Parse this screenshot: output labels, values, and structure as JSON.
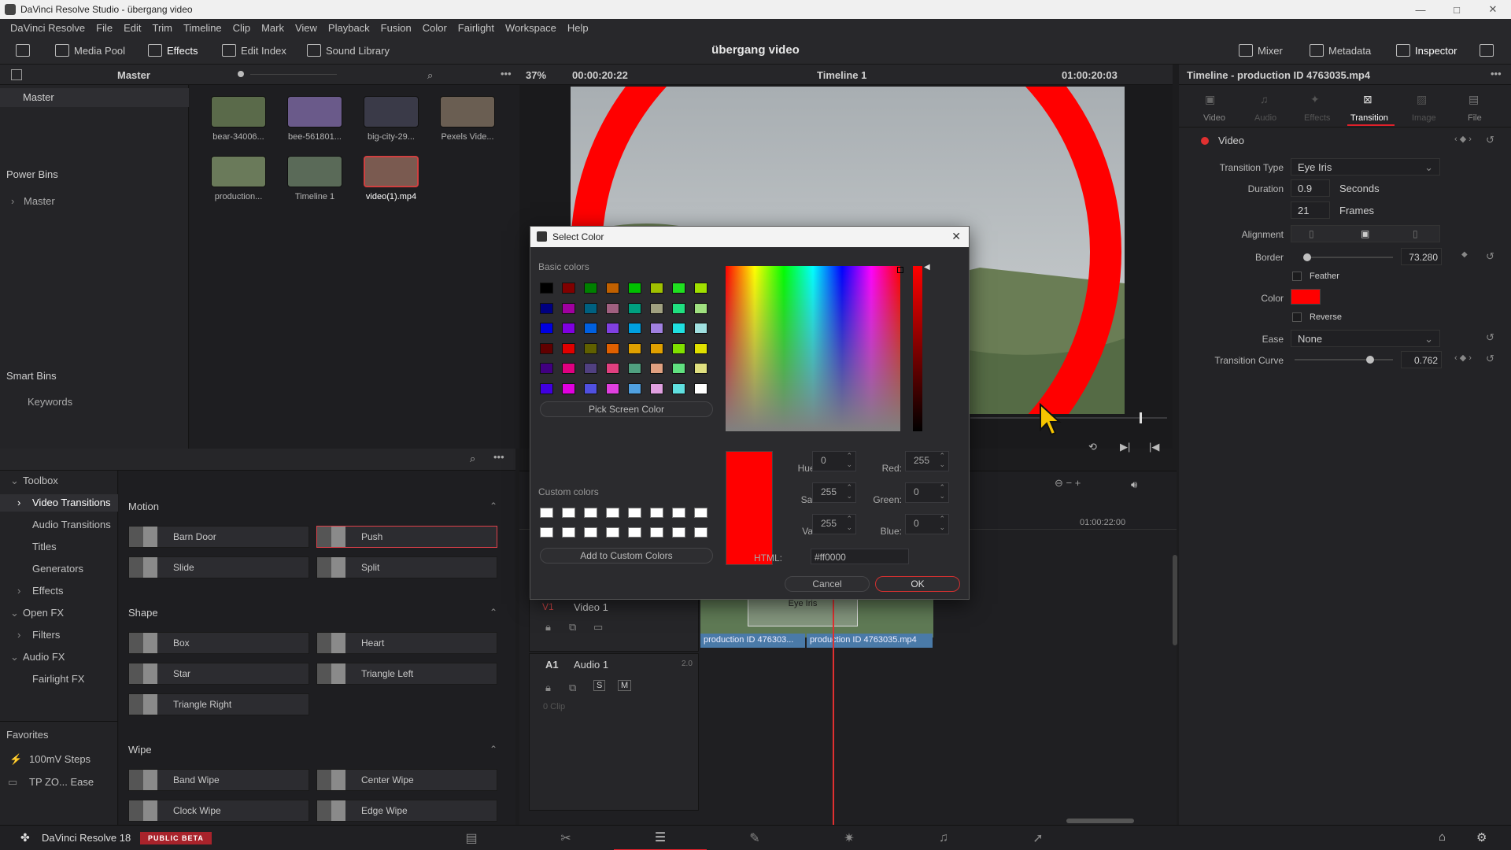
{
  "window": {
    "title": "DaVinci Resolve Studio - übergang video",
    "minimize": "—",
    "maximize": "□",
    "close": "✕"
  },
  "menu": [
    "DaVinci Resolve",
    "File",
    "Edit",
    "Trim",
    "Timeline",
    "Clip",
    "Mark",
    "View",
    "Playback",
    "Fusion",
    "Color",
    "Fairlight",
    "Workspace",
    "Help"
  ],
  "toolbar": {
    "media_pool": "Media Pool",
    "effects": "Effects",
    "edit_index": "Edit Index",
    "sound_library": "Sound Library",
    "project_title": "übergang video",
    "mixer": "Mixer",
    "metadata": "Metadata",
    "inspector": "Inspector"
  },
  "bins": {
    "header": "Master",
    "master": "Master",
    "power_bins": "Power Bins",
    "power_master": "Master",
    "smart_bins": "Smart Bins",
    "keywords": "Keywords"
  },
  "media": [
    {
      "label": "bear-34006...",
      "color": "#5a6a4a"
    },
    {
      "label": "bee-561801...",
      "color": "#6a5a8a"
    },
    {
      "label": "big-city-29...",
      "color": "#3a3a48"
    },
    {
      "label": "Pexels Vide...",
      "color": "#6a5e52"
    },
    {
      "label": "production...",
      "color": "#6a7a5a"
    },
    {
      "label": "Timeline 1",
      "color": "#5a6a58"
    },
    {
      "label": "video(1).mp4",
      "color": "#7a5a50"
    }
  ],
  "viewer": {
    "zoom": "37%",
    "source_tc": "00:00:20:22",
    "timeline_name": "Timeline 1",
    "record_tc": "01:00:20:03"
  },
  "effects_tree": {
    "toolbox": "Toolbox",
    "video_transitions": "Video Transitions",
    "audio_transitions": "Audio Transitions",
    "titles": "Titles",
    "generators": "Generators",
    "effects": "Effects",
    "open_fx": "Open FX",
    "filters": "Filters",
    "audio_fx": "Audio FX",
    "fairlight_fx": "Fairlight FX",
    "favorites": "Favorites",
    "fav1": "100mV Steps",
    "fav2": "TP ZO... Ease"
  },
  "effects_list": {
    "motion": "Motion",
    "barn_door": "Barn Door",
    "push": "Push",
    "slide": "Slide",
    "split": "Split",
    "shape": "Shape",
    "box": "Box",
    "heart": "Heart",
    "star": "Star",
    "triangle_left": "Triangle Left",
    "triangle_right": "Triangle Right",
    "wipe": "Wipe",
    "band_wipe": "Band Wipe",
    "center_wipe": "Center Wipe",
    "clock_wipe": "Clock Wipe",
    "edge_wipe": "Edge Wipe"
  },
  "dialog": {
    "title": "Select Color",
    "basic_colors": "Basic colors",
    "pick_screen": "Pick Screen Color",
    "custom_colors": "Custom colors",
    "add_custom": "Add to Custom Colors",
    "hue_label": "Hue:",
    "hue": "0",
    "sat_label": "Sat:",
    "sat": "255",
    "val_label": "Val:",
    "val": "255",
    "red_label": "Red:",
    "red": "255",
    "green_label": "Green:",
    "green": "0",
    "blue_label": "Blue:",
    "blue": "0",
    "html_label": "HTML:",
    "html": "#ff0000",
    "cancel": "Cancel",
    "ok": "OK",
    "swatches": [
      "#000000",
      "#800000",
      "#008000",
      "#c06000",
      "#00c000",
      "#a0c000",
      "#20e020",
      "#a0e000",
      "#000080",
      "#a000a0",
      "#006080",
      "#a06080",
      "#00a080",
      "#a0a080",
      "#20e080",
      "#a0e080",
      "#0000e0",
      "#8000e0",
      "#0060e0",
      "#8040e0",
      "#00a0e0",
      "#a080e0",
      "#20e0e0",
      "#a0e0e0",
      "#600000",
      "#e00000",
      "#606000",
      "#e06000",
      "#e0a000",
      "#e0a000",
      "#80e000",
      "#e0e000",
      "#400080",
      "#e00080",
      "#504080",
      "#e04080",
      "#50a080",
      "#e0a080",
      "#60e080",
      "#e0e080",
      "#4000e0",
      "#e000e0",
      "#5050e0",
      "#e040e0",
      "#50a0e0",
      "#e0a0e0",
      "#60e0e0",
      "#ffffff"
    ]
  },
  "timeline": {
    "tc_mark": "01:00:22:00",
    "v1": "V1",
    "video1": "Video 1",
    "a1": "A1",
    "audio1": "Audio 1",
    "audio_level": "2.0",
    "zero_clip": "0 Clip",
    "transition_label": "Eye Iris",
    "clip1": "production ID 476303...",
    "clip2": "production ID 4763035.mp4"
  },
  "inspector": {
    "title": "Timeline - production ID 4763035.mp4",
    "tabs": [
      "Video",
      "Audio",
      "Effects",
      "Transition",
      "Image",
      "File"
    ],
    "section": "Video",
    "transition_type_label": "Transition Type",
    "transition_type": "Eye Iris",
    "duration_label": "Duration",
    "duration_seconds": "0.9",
    "seconds_unit": "Seconds",
    "duration_frames": "21",
    "frames_unit": "Frames",
    "alignment_label": "Alignment",
    "border_label": "Border",
    "border": "73.280",
    "feather_label": "Feather",
    "color_label": "Color",
    "reverse_label": "Reverse",
    "ease_label": "Ease",
    "ease": "None",
    "curve_label": "Transition Curve",
    "curve": "0.762"
  },
  "bottom": {
    "app": "DaVinci Resolve 18",
    "badge": "PUBLIC BETA"
  },
  "colors": {
    "accent_red": "#ff0000",
    "bg": "#1c1c1e",
    "tab_active": "#e0202a"
  }
}
